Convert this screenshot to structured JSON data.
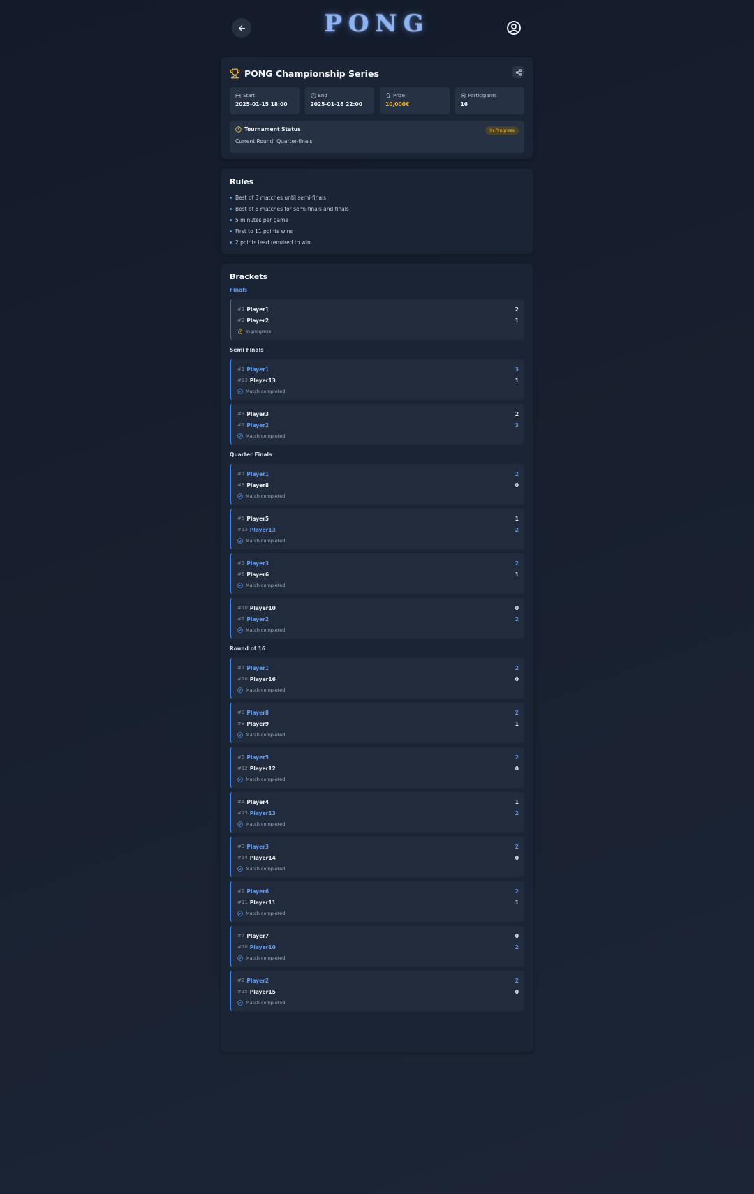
{
  "header": {
    "logo": "PONG"
  },
  "tournament": {
    "title": "PONG Championship Series",
    "stats": [
      {
        "label": "Start",
        "value": "2025-01-15 18:00",
        "icon": "calendar-icon"
      },
      {
        "label": "End",
        "value": "2025-01-16 22:00",
        "icon": "clock-icon"
      },
      {
        "label": "Prize",
        "value": "10,000€",
        "icon": "award-icon"
      },
      {
        "label": "Participants",
        "value": "16",
        "icon": "users-icon"
      }
    ],
    "status_title": "Tournament Status",
    "status_badge": "In Progress",
    "current_round": "Current Round: Quarter-finals"
  },
  "rules": {
    "title": "Rules",
    "items": [
      "Best of 3 matches until semi-finals",
      "Best of 5 matches for semi-finals and finals",
      "5 minutes per game",
      "First to 11 points wins",
      "2 points lead required to win"
    ]
  },
  "brackets": {
    "title": "Brackets",
    "rounds": [
      {
        "name": "Finals",
        "matches": [
          {
            "status": "In progress",
            "live": true,
            "p1": {
              "seed": "#1",
              "name": "Player1",
              "score": "2",
              "win": false
            },
            "p2": {
              "seed": "#2",
              "name": "Player2",
              "score": "1",
              "win": false
            }
          }
        ]
      },
      {
        "name": "Semi Finals",
        "matches": [
          {
            "status": "Match completed",
            "p1": {
              "seed": "#1",
              "name": "Player1",
              "score": "3",
              "win": true
            },
            "p2": {
              "seed": "#13",
              "name": "Player13",
              "score": "1",
              "win": false
            }
          },
          {
            "status": "Match completed",
            "p1": {
              "seed": "#3",
              "name": "Player3",
              "score": "2",
              "win": false
            },
            "p2": {
              "seed": "#2",
              "name": "Player2",
              "score": "3",
              "win": true
            }
          }
        ]
      },
      {
        "name": "Quarter Finals",
        "matches": [
          {
            "status": "Match completed",
            "p1": {
              "seed": "#1",
              "name": "Player1",
              "score": "2",
              "win": true
            },
            "p2": {
              "seed": "#8",
              "name": "Player8",
              "score": "0",
              "win": false
            }
          },
          {
            "status": "Match completed",
            "p1": {
              "seed": "#5",
              "name": "Player5",
              "score": "1",
              "win": false
            },
            "p2": {
              "seed": "#13",
              "name": "Player13",
              "score": "2",
              "win": true
            }
          },
          {
            "status": "Match completed",
            "p1": {
              "seed": "#3",
              "name": "Player3",
              "score": "2",
              "win": true
            },
            "p2": {
              "seed": "#6",
              "name": "Player6",
              "score": "1",
              "win": false
            }
          },
          {
            "status": "Match completed",
            "p1": {
              "seed": "#10",
              "name": "Player10",
              "score": "0",
              "win": false
            },
            "p2": {
              "seed": "#2",
              "name": "Player2",
              "score": "2",
              "win": true
            }
          }
        ]
      },
      {
        "name": "Round of 16",
        "matches": [
          {
            "status": "Match completed",
            "p1": {
              "seed": "#1",
              "name": "Player1",
              "score": "2",
              "win": true
            },
            "p2": {
              "seed": "#16",
              "name": "Player16",
              "score": "0",
              "win": false
            }
          },
          {
            "status": "Match completed",
            "p1": {
              "seed": "#8",
              "name": "Player8",
              "score": "2",
              "win": true
            },
            "p2": {
              "seed": "#9",
              "name": "Player9",
              "score": "1",
              "win": false
            }
          },
          {
            "status": "Match completed",
            "p1": {
              "seed": "#5",
              "name": "Player5",
              "score": "2",
              "win": true
            },
            "p2": {
              "seed": "#12",
              "name": "Player12",
              "score": "0",
              "win": false
            }
          },
          {
            "status": "Match completed",
            "p1": {
              "seed": "#4",
              "name": "Player4",
              "score": "1",
              "win": false
            },
            "p2": {
              "seed": "#13",
              "name": "Player13",
              "score": "2",
              "win": true
            }
          },
          {
            "status": "Match completed",
            "p1": {
              "seed": "#3",
              "name": "Player3",
              "score": "2",
              "win": true
            },
            "p2": {
              "seed": "#14",
              "name": "Player14",
              "score": "0",
              "win": false
            }
          },
          {
            "status": "Match completed",
            "p1": {
              "seed": "#6",
              "name": "Player6",
              "score": "2",
              "win": true
            },
            "p2": {
              "seed": "#11",
              "name": "Player11",
              "score": "1",
              "win": false
            }
          },
          {
            "status": "Match completed",
            "p1": {
              "seed": "#7",
              "name": "Player7",
              "score": "0",
              "win": false
            },
            "p2": {
              "seed": "#10",
              "name": "Player10",
              "score": "2",
              "win": true
            }
          },
          {
            "status": "Match completed",
            "p1": {
              "seed": "#2",
              "name": "Player2",
              "score": "2",
              "win": true
            },
            "p2": {
              "seed": "#15",
              "name": "Player15",
              "score": "0",
              "win": false
            }
          }
        ]
      }
    ]
  },
  "colors": {
    "accent": "#5b9bf8",
    "gold": "#f0b429",
    "card": "#1b2435",
    "background": "#151c2b"
  }
}
